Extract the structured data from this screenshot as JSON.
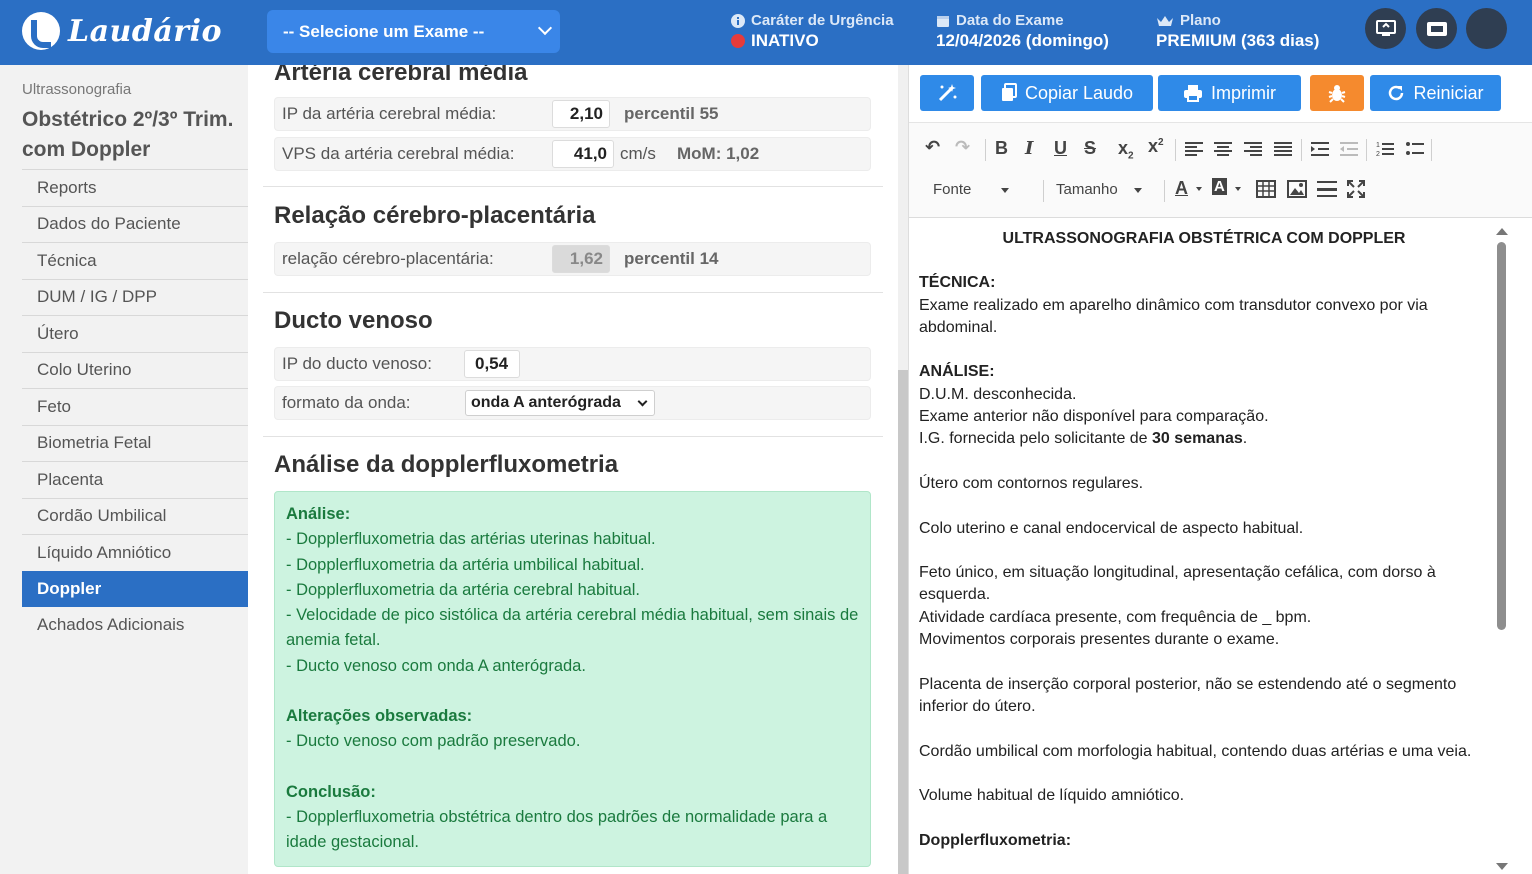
{
  "header": {
    "logo_text": "Laudário",
    "exam_select": "-- Selecione um Exame --",
    "urgency": {
      "label": "Caráter de Urgência",
      "value": "INATIVO"
    },
    "exam_date": {
      "label": "Data do Exame",
      "value": "12/04/2026 (domingo)"
    },
    "plan": {
      "label": "Plano",
      "value": "PREMIUM (363 dias)"
    }
  },
  "nav": {
    "category": "Ultrassonografia",
    "title": "Obstétrico 2º/3º Trim. com Doppler",
    "items": [
      {
        "label": "Reports",
        "active": false
      },
      {
        "label": "Dados do Paciente",
        "active": false
      },
      {
        "label": "Técnica",
        "active": false
      },
      {
        "label": "DUM / IG / DPP",
        "active": false
      },
      {
        "label": "Útero",
        "active": false
      },
      {
        "label": "Colo Uterino",
        "active": false
      },
      {
        "label": "Feto",
        "active": false
      },
      {
        "label": "Biometria Fetal",
        "active": false
      },
      {
        "label": "Placenta",
        "active": false
      },
      {
        "label": "Cordão Umbilical",
        "active": false
      },
      {
        "label": "Líquido Amniótico",
        "active": false
      },
      {
        "label": "Doppler",
        "active": true
      },
      {
        "label": "Achados Adicionais",
        "active": false
      }
    ]
  },
  "form": {
    "acm": {
      "title": "Artéria cerebral média",
      "ip_label": "IP da artéria cerebral média:",
      "ip_value": "2,10",
      "ip_extra": "percentil 55",
      "vps_label": "VPS da artéria cerebral média:",
      "vps_value": "41,0",
      "vps_unit": "cm/s",
      "vps_extra": "MoM: 1,02"
    },
    "rcp": {
      "title": "Relação cérebro-placentária",
      "label": "relação cérebro-placentária:",
      "value": "1,62",
      "extra": "percentil 14"
    },
    "dv": {
      "title": "Ducto venoso",
      "ip_label": "IP do ducto venoso:",
      "ip_value": "0,54",
      "wave_label": "formato da onda:",
      "wave_value": "onda A anterógrada"
    },
    "analysis": {
      "title": "Análise da dopplerfluxometria",
      "h1": "Análise:",
      "l1": "- Dopplerfluxometria das artérias uterinas habitual.",
      "l2": "- Dopplerfluxometria da artéria umbilical habitual.",
      "l3": "- Dopplerfluxometria da artéria cerebral habitual.",
      "l4": "- Velocidade de pico sistólica da artéria cerebral média habitual, sem sinais de anemia fetal.",
      "l5": "- Ducto venoso com onda A anterógrada.",
      "h2": "Alterações observadas:",
      "l6": "- Ducto venoso com padrão preservado.",
      "h3": "Conclusão:",
      "l7": "- Dopplerfluxometria obstétrica dentro dos padrões de normalidade para a idade gestacional."
    }
  },
  "toolbar": {
    "copy": "Copiar Laudo",
    "print": "Imprimir",
    "restart": "Reiniciar",
    "font": "Fonte",
    "size": "Tamanho"
  },
  "report": {
    "title": "ULTRASSONOGRAFIA OBSTÉTRICA COM DOPPLER",
    "tec_h": "TÉCNICA:",
    "tec": "Exame realizado em aparelho dinâmico com transdutor convexo por via abdominal.",
    "an_h": "ANÁLISE:",
    "a1": "D.U.M. desconhecida.",
    "a2": "Exame anterior não disponível para comparação.",
    "a3_pre": "I.G. fornecida pelo solicitante de ",
    "a3_bold": "30 semanas",
    "a3_post": ".",
    "p1": "Útero com contornos regulares.",
    "p2": "Colo uterino e canal endocervical de aspecto habitual.",
    "p3a": "Feto único, em situação longitudinal, apresentação cefálica, com dorso à esquerda.",
    "p3b": "Atividade cardíaca presente, com frequência de _ bpm.",
    "p3c": "Movimentos corporais presentes durante o exame.",
    "p4": "Placenta de inserção corporal posterior, não se estendendo até o segmento inferior do útero.",
    "p5": "Cordão umbilical com morfologia habitual, contendo duas artérias e uma veia.",
    "p6": "Volume habitual de líquido amniótico.",
    "dop_h": "Dopplerfluxometria:"
  }
}
